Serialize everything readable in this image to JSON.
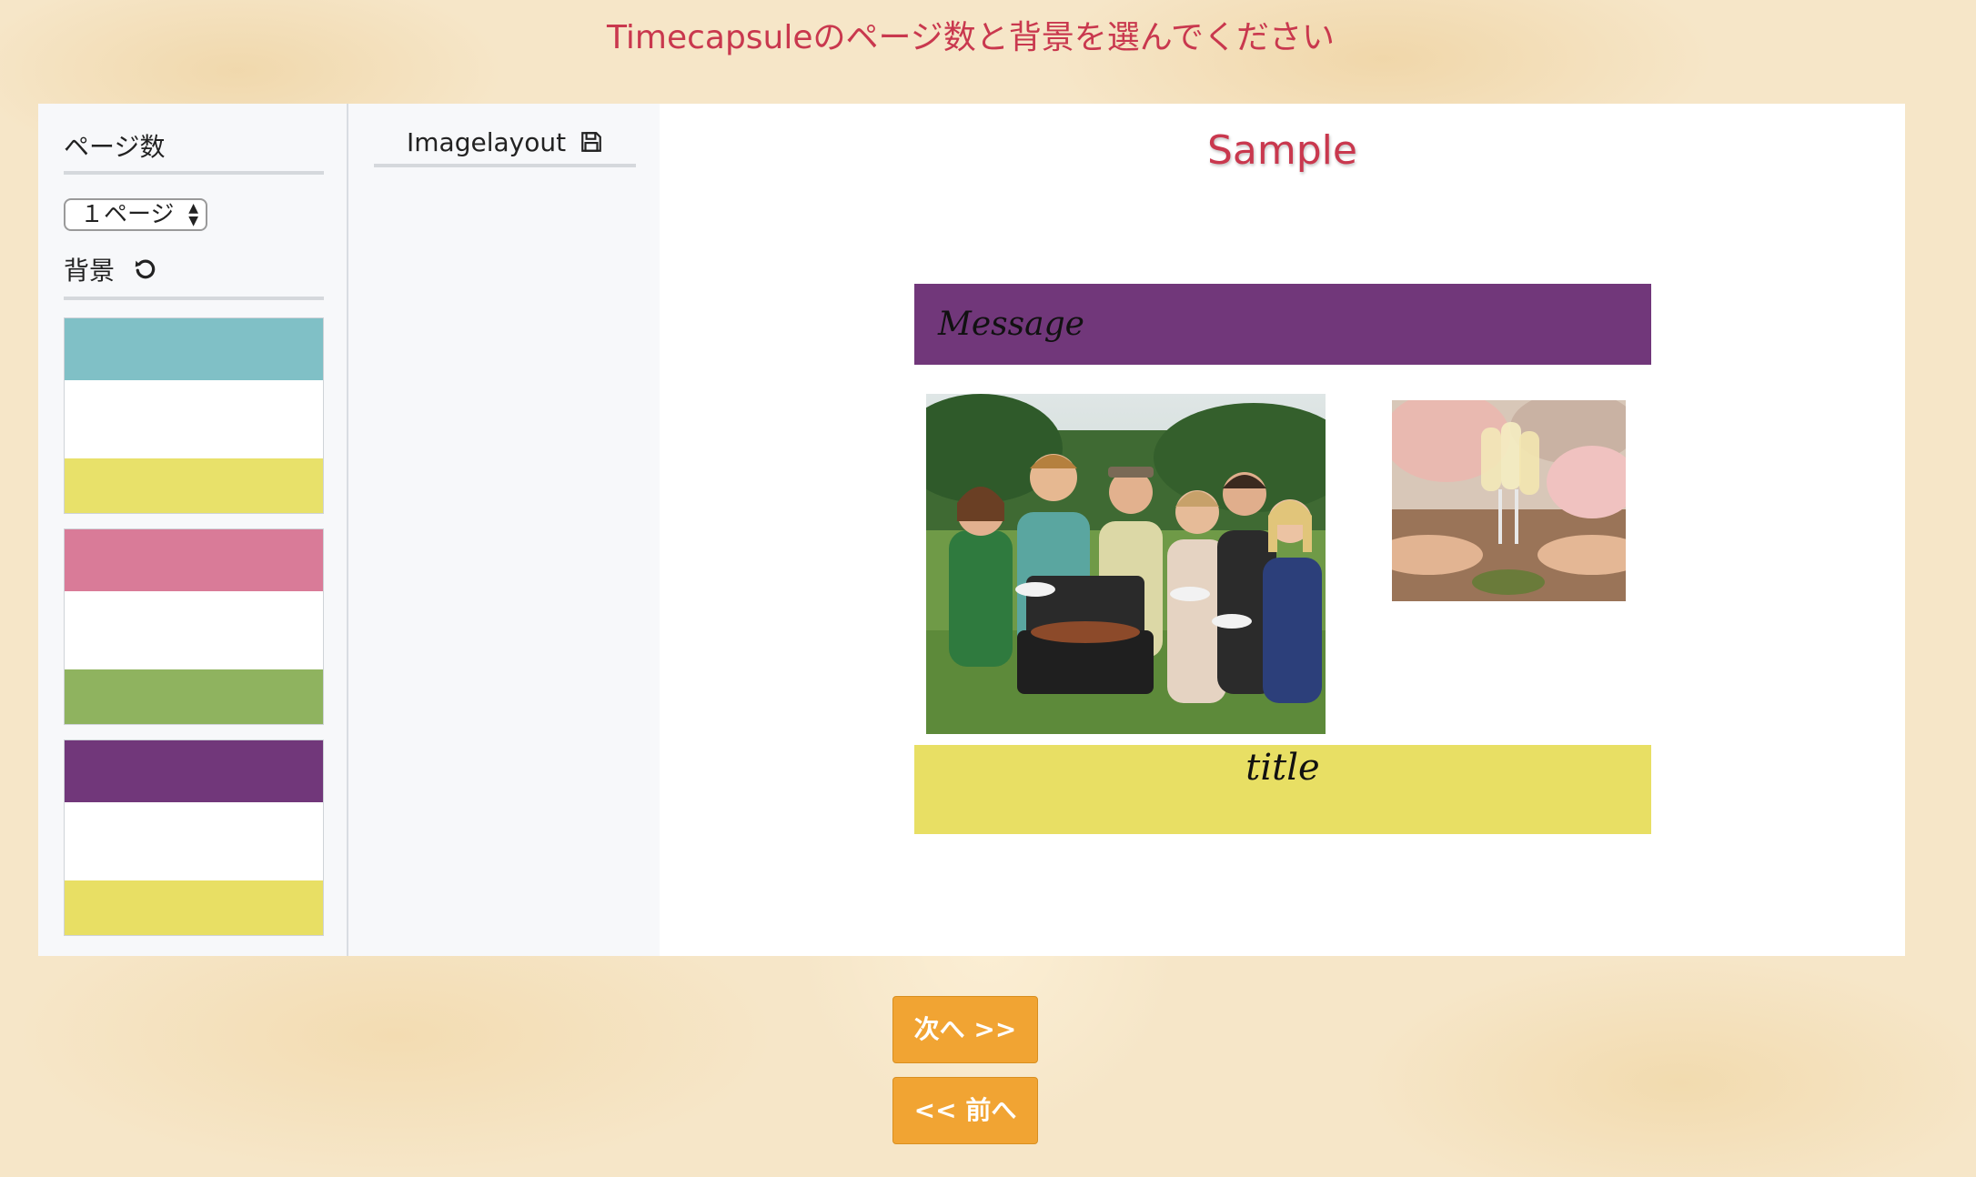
{
  "header": {
    "title": "Timecapsuleのページ数と背景を選んでください"
  },
  "settings": {
    "pages_label": "ページ数",
    "pages_value": "１ページ",
    "background_label": "背景",
    "swatches": [
      {
        "top": "#80c0c6",
        "bottom": "#e8e16a"
      },
      {
        "top": "#d97b98",
        "bottom": "#8fb35f"
      },
      {
        "top": "#71377a",
        "bottom": "#e8df64"
      }
    ]
  },
  "layout": {
    "title": "Imagelayout"
  },
  "sample": {
    "title": "Sample",
    "message": "Message",
    "caption": "title",
    "message_color": "#71377a",
    "caption_color": "#e8df64"
  },
  "nav": {
    "next_label": "次へ >>",
    "prev_label": "<< 前へ"
  }
}
